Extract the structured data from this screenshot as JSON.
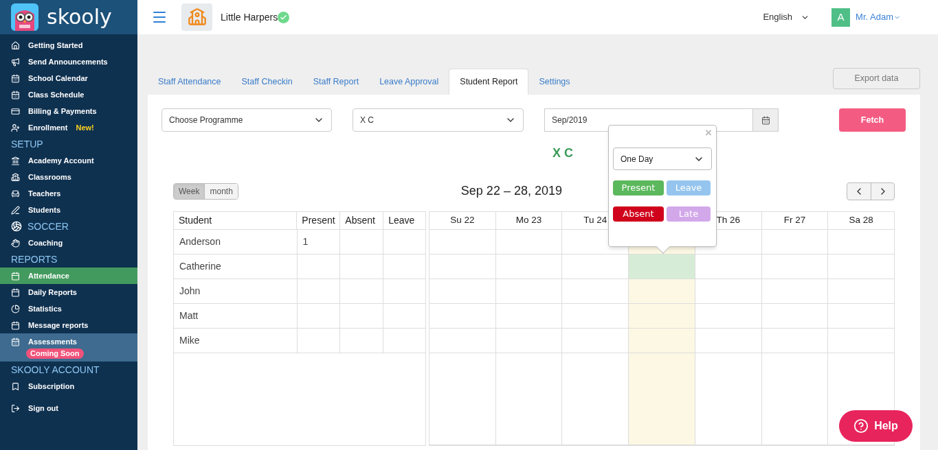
{
  "brand": {
    "name": "skooly"
  },
  "sidebar": {
    "sections": [
      {
        "items": [
          {
            "label": "Getting Started",
            "selected": false,
            "hovered": false
          },
          {
            "label": "Send Announcements",
            "selected": false,
            "hovered": false
          },
          {
            "label": "School Calendar",
            "selected": false,
            "hovered": false
          },
          {
            "label": "Class Schedule",
            "selected": false,
            "hovered": false
          },
          {
            "label": "Billing & Payments",
            "selected": false,
            "hovered": false
          },
          {
            "label": "Enrollment",
            "badge": "New!",
            "selected": false,
            "hovered": false
          }
        ]
      },
      {
        "title": "SETUP",
        "items": [
          {
            "label": "Academy Account",
            "selected": false,
            "hovered": false
          },
          {
            "label": "Classrooms",
            "selected": false,
            "hovered": false
          },
          {
            "label": "Teachers",
            "selected": false,
            "hovered": false
          },
          {
            "label": "Students",
            "selected": false,
            "hovered": false
          }
        ]
      },
      {
        "title": "SOCCER",
        "items": [
          {
            "label": "Coaching",
            "selected": false,
            "hovered": false
          }
        ]
      },
      {
        "title": "REPORTS",
        "items": [
          {
            "label": "Attendance",
            "selected": true,
            "hovered": false
          },
          {
            "label": "Daily Reports",
            "selected": false,
            "hovered": false
          },
          {
            "label": "Statistics",
            "selected": false,
            "hovered": false
          },
          {
            "label": "Message reports",
            "selected": false,
            "hovered": false
          },
          {
            "label": "Assessments",
            "pill": "Coming Soon",
            "selected": false,
            "hovered": true
          }
        ]
      },
      {
        "title": "SKOOLY ACCOUNT",
        "items": [
          {
            "label": "Subscription",
            "selected": false,
            "hovered": false
          }
        ]
      },
      {
        "items": [
          {
            "label": "Sign out",
            "selected": false,
            "hovered": false
          }
        ]
      }
    ]
  },
  "header": {
    "school": "Little Harpers",
    "verified": true,
    "language": "English",
    "avatar_letter": "A",
    "user": "Mr. Adam"
  },
  "tabs": [
    {
      "label": "Staff Attendance",
      "selected": false
    },
    {
      "label": "Staff Checkin",
      "selected": false
    },
    {
      "label": "Staff Report",
      "selected": false
    },
    {
      "label": "Leave Approval",
      "selected": false
    },
    {
      "label": "Student Report",
      "selected": true
    },
    {
      "label": "Settings",
      "selected": false
    }
  ],
  "export_button": "Export data",
  "filters": {
    "programme": "Choose Programme",
    "class": "X C",
    "month": "Sep/2019",
    "fetch": "Fetch"
  },
  "class_title": "X C",
  "view_toggle": [
    {
      "label": "Week",
      "selected": true
    },
    {
      "label": "month",
      "selected": false
    }
  ],
  "range_title": "Sep 22 – 28, 2019",
  "summary_columns": [
    "Student",
    "Present",
    "Absent",
    "Leave"
  ],
  "days": [
    {
      "label": "Su 22",
      "today": false
    },
    {
      "label": "Mo 23",
      "today": false
    },
    {
      "label": "Tu 24",
      "today": false
    },
    {
      "today": true
    },
    {
      "label": "Th 26",
      "today": false
    },
    {
      "label": "Fr 27",
      "today": false
    },
    {
      "label": "Sa 28",
      "today": false
    }
  ],
  "rows": [
    {
      "student": "Anderson",
      "present": "1",
      "selected_cells": [
        false,
        false,
        false,
        false,
        false,
        false,
        false
      ]
    },
    {
      "student": "Catherine",
      "selected_cells": [
        false,
        false,
        false,
        true,
        false,
        false,
        false
      ]
    },
    {
      "student": "John",
      "selected_cells": [
        false,
        false,
        false,
        false,
        false,
        false,
        false
      ]
    },
    {
      "student": "Matt",
      "selected_cells": [
        false,
        false,
        false,
        false,
        false,
        false,
        false
      ]
    },
    {
      "student": "Mike",
      "selected_cells": [
        false,
        false,
        false,
        false,
        false,
        false,
        false
      ]
    }
  ],
  "popover": {
    "close": "×",
    "duration": "One Day",
    "options": [
      {
        "label": "Present",
        "color": "#5cb85c"
      },
      {
        "label": "Leave",
        "color": "#95c5ee"
      },
      {
        "label": "Absent",
        "color": "#d0021b"
      },
      {
        "label": "Late",
        "color": "#d2a8ea"
      }
    ]
  },
  "help_button": "Help"
}
